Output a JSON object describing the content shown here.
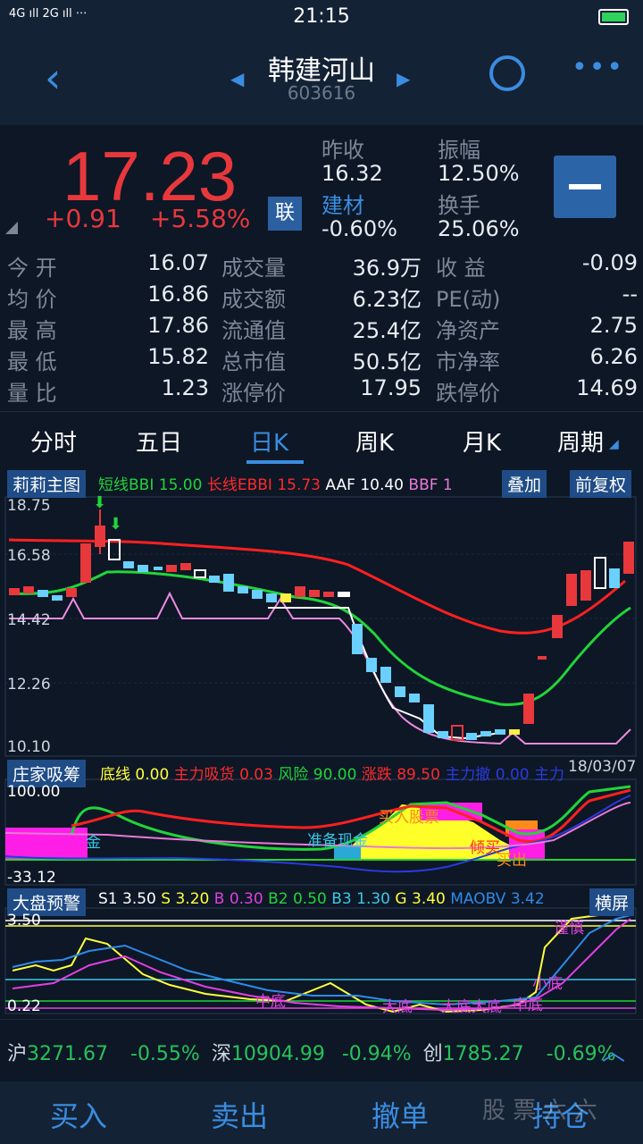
{
  "status": {
    "signal": "4G ıll 2G ıll  ⋅⋅⋅",
    "time": "21:15"
  },
  "header": {
    "title": "韩建河山",
    "code": "603616"
  },
  "quote": {
    "price": "17.23",
    "change": "+0.91",
    "change_pct": "+5.58%",
    "badge": "联",
    "prev_close_label": "昨收",
    "prev_close": "16.32",
    "amplitude_label": "振幅",
    "amplitude": "12.50%",
    "sector_label": "建材",
    "sector_chg": "-0.60%",
    "turnover_label": "换手",
    "turnover": "25.06%"
  },
  "stats": [
    [
      "今    开",
      "16.07",
      "成交量",
      "36.9万",
      "收    益",
      "-0.09"
    ],
    [
      "均    价",
      "16.86",
      "成交额",
      "6.23亿",
      "PE(动)",
      "--"
    ],
    [
      "最    高",
      "17.86",
      "流通值",
      "25.4亿",
      "净资产",
      "2.75"
    ],
    [
      "最    低",
      "15.82",
      "总市值",
      "50.5亿",
      "市净率",
      "6.26"
    ],
    [
      "量    比",
      "1.23",
      "涨停价",
      "17.95",
      "跌停价",
      "14.69"
    ]
  ],
  "tabs": [
    "分时",
    "五日",
    "日K",
    "周K",
    "月K",
    "周期"
  ],
  "main_chart": {
    "name": "莉莉主图",
    "legend": [
      {
        "t": "短线BBI",
        "v": "15.00",
        "c": "#22d43a"
      },
      {
        "t": "长线EBBI",
        "v": "15.73",
        "c": "#ff2a2a"
      },
      {
        "t": "AAF",
        "v": "10.40",
        "c": "#ffffff"
      },
      {
        "t": "BBF",
        "v": "1",
        "c": "#e87ad8"
      }
    ],
    "overlay_btn": "叠加",
    "adjust_btn": "前复权",
    "y_ticks": [
      "18.75",
      "16.58",
      "14.42",
      "12.26",
      "10.10"
    ],
    "date": "18/03/07"
  },
  "sub1": {
    "name": "庄家吸筹",
    "legend": [
      {
        "t": "底线",
        "v": "0.00",
        "c": "#ffff3a"
      },
      {
        "t": "主力吸货",
        "v": "0.03",
        "c": "#ff2a2a"
      },
      {
        "t": "风险",
        "v": "90.00",
        "c": "#22d43a"
      },
      {
        "t": "涨跌",
        "v": "89.50",
        "c": "#ff2a2a"
      },
      {
        "t": "主力撤",
        "v": "0.00",
        "c": "#2a3adf"
      },
      {
        "t": "主力",
        "v": "",
        "c": "#2a3adf"
      }
    ],
    "y_ticks": [
      "100.00",
      "-33.12"
    ],
    "annotations": [
      "金",
      "准备现金",
      "买入股票",
      "倾买",
      "买出"
    ]
  },
  "sub2": {
    "name": "大盘预警",
    "legend": [
      {
        "t": "S1",
        "v": "3.50",
        "c": "#ffffff"
      },
      {
        "t": "S",
        "v": "3.20",
        "c": "#ffff3a"
      },
      {
        "t": "B",
        "v": "0.30",
        "c": "#e040e0"
      },
      {
        "t": "B2",
        "v": "0.50",
        "c": "#22d43a"
      },
      {
        "t": "B3",
        "v": "1.30",
        "c": "#3ac8e8"
      },
      {
        "t": "G",
        "v": "3.40",
        "c": "#ffff3a"
      },
      {
        "t": "MAOBV",
        "v": "3.42",
        "c": "#2e8be8"
      }
    ],
    "rotate_btn": "横屏",
    "y_ticks": [
      "3.50",
      "0.22"
    ],
    "annotations": [
      "中底",
      "大底",
      "大底大底",
      "中底",
      "小底",
      "谨慎"
    ]
  },
  "market": [
    {
      "name": "沪",
      "val": "3271.67",
      "pct": "-0.55%"
    },
    {
      "name": "深",
      "val": "10904.99",
      "pct": "-0.94%"
    },
    {
      "name": "创",
      "val": "1785.27",
      "pct": "-0.69%"
    }
  ],
  "actions": [
    "买入",
    "卖出",
    "撤单",
    "持仓"
  ],
  "watermark": "股 票 六 六"
}
